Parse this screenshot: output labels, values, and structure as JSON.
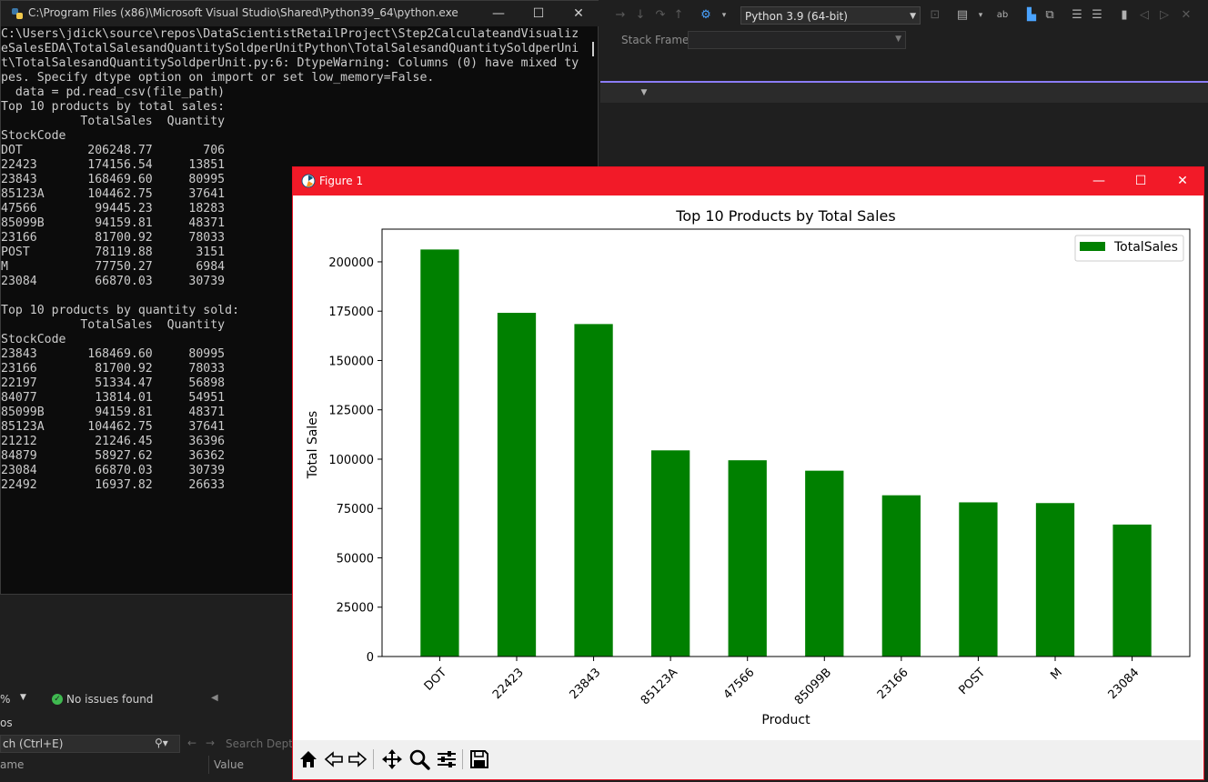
{
  "console": {
    "title": "C:\\Program Files (x86)\\Microsoft Visual Studio\\Shared\\Python39_64\\python.exe",
    "output": "C:\\Users\\jdick\\source\\repos\\DataScientistRetailProject\\Step2CalculateandVisualiz\neSalesEDA\\TotalSalesandQuantitySoldperUnitPython\\TotalSalesandQuantitySoldperUni\nt\\TotalSalesandQuantitySoldperUnit.py:6: DtypeWarning: Columns (0) have mixed ty\npes. Specify dtype option on import or set low_memory=False.\n  data = pd.read_csv(file_path)\nTop 10 products by total sales:\n           TotalSales  Quantity\nStockCode\nDOT         206248.77       706\n22423       174156.54     13851\n23843       168469.60     80995\n85123A      104462.75     37641\n47566        99445.23     18283\n85099B       94159.81     48371\n23166        81700.92     78033\nPOST         78119.88      3151\nM            77750.27      6984\n23084        66870.03     30739\n\nTop 10 products by quantity sold:\n           TotalSales  Quantity\nStockCode\n23843       168469.60     80995\n23166        81700.92     78033\n22197        51334.47     56898\n84077        13814.01     54951\n85099B       94159.81     48371\n85123A      104462.75     37641\n21212        21246.45     36396\n84879        58927.62     36362\n23084        66870.03     30739\n22492        16937.82     26633"
  },
  "vs": {
    "python_env": "Python 3.9 (64-bit)",
    "stack_frame_label": "Stack Frame:",
    "zoom": "%",
    "issues": "No issues found",
    "panel_title": "os",
    "search_placeholder": "ch (Ctrl+E)",
    "search_depth": "Search Depth:",
    "col_name": "ame",
    "col_value": "Value"
  },
  "figure": {
    "title": "Figure 1"
  },
  "chart_data": {
    "type": "bar",
    "title": "Top 10 Products by Total Sales",
    "xlabel": "Product",
    "ylabel": "Total Sales",
    "categories": [
      "DOT",
      "22423",
      "23843",
      "85123A",
      "47566",
      "85099B",
      "23166",
      "POST",
      "M",
      "23084"
    ],
    "series": [
      {
        "name": "TotalSales",
        "values": [
          206248.77,
          174156.54,
          168469.6,
          104462.75,
          99445.23,
          94159.81,
          81700.92,
          78119.88,
          77750.27,
          66870.03
        ],
        "color": "#008000"
      }
    ],
    "ylim": [
      0,
      216561.21
    ],
    "yticks": [
      0,
      25000,
      50000,
      75000,
      100000,
      125000,
      150000,
      175000,
      200000
    ],
    "legend": "top-right",
    "grid": false
  }
}
